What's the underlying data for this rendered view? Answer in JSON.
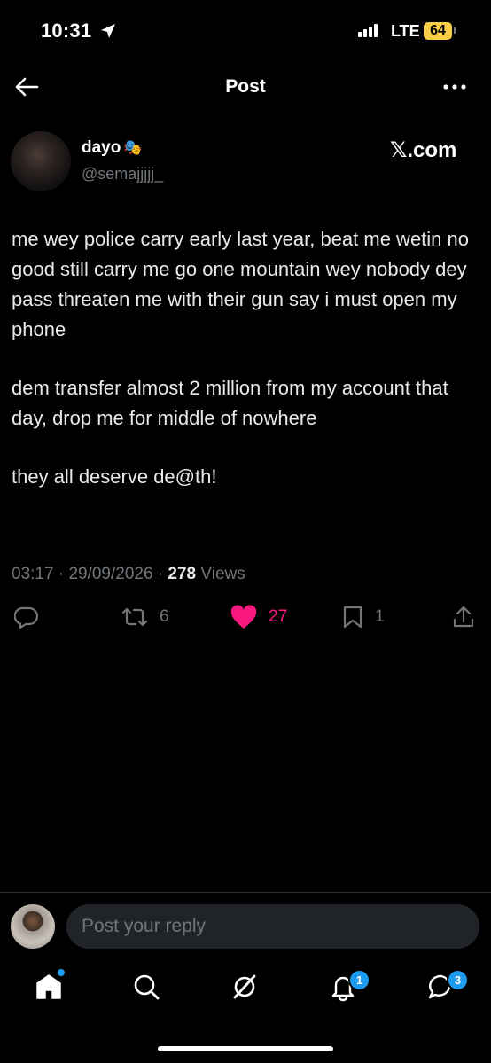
{
  "status_bar": {
    "time": "10:31",
    "network": "LTE",
    "battery": "64"
  },
  "header": {
    "title": "Post"
  },
  "author": {
    "name": "dayo",
    "name_emoji": "🎭",
    "handle": "@semajjjjj_",
    "source": "𝕏.com"
  },
  "post": {
    "paragraphs": [
      "me wey police carry early last year, beat me wetin no good still carry me go one mountain wey nobody dey pass threaten me with their gun say i must open my phone",
      "dem transfer almost 2 million from my account that day, drop me for middle of nowhere",
      "they all deserve de@th!"
    ],
    "time": "03:17",
    "date": "29/09/2026",
    "views_count": "278",
    "views_label": "Views"
  },
  "actions": {
    "reposts": "6",
    "likes": "27",
    "bookmarks": "1"
  },
  "reply": {
    "placeholder": "Post your reply"
  },
  "nav": {
    "notifications_badge": "1",
    "messages_badge": "3"
  },
  "colors": {
    "like": "#f91880",
    "accent": "#1d9bf0",
    "muted": "#71767b",
    "battery": "#f7ce46"
  }
}
